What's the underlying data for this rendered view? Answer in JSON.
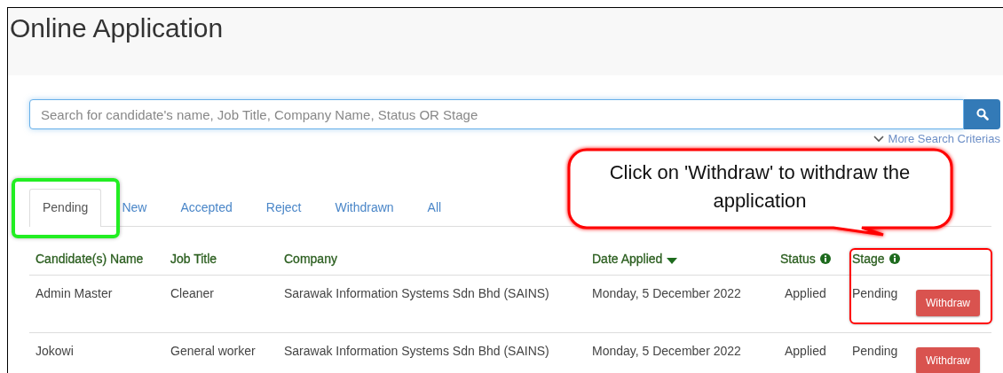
{
  "page_title": "Online Application",
  "search": {
    "placeholder": "Search for candidate's name, Job Title, Company Name, Status OR Stage"
  },
  "more_criteria": "More Search Criterias",
  "tabs": [
    {
      "label": "Pending",
      "selected": true
    },
    {
      "label": "New",
      "selected": false
    },
    {
      "label": "Accepted",
      "selected": false
    },
    {
      "label": "Reject",
      "selected": false
    },
    {
      "label": "Withdrawn",
      "selected": false
    },
    {
      "label": "All",
      "selected": false
    }
  ],
  "table": {
    "columns": [
      {
        "label": "Candidate(s) Name",
        "info": false,
        "sorted": false
      },
      {
        "label": "Job Title",
        "info": false,
        "sorted": false
      },
      {
        "label": "Company",
        "info": false,
        "sorted": false
      },
      {
        "label": "Date Applied",
        "info": false,
        "sorted": true
      },
      {
        "label": "Status",
        "info": true,
        "sorted": false
      },
      {
        "label": "Stage",
        "info": true,
        "sorted": false
      }
    ],
    "rows": [
      {
        "candidate": "Admin Master",
        "job_title": "Cleaner",
        "company": "Sarawak Information Systems Sdn Bhd (SAINS)",
        "date_applied": "Monday, 5 December 2022",
        "status": "Applied",
        "stage": "Pending",
        "action": "Withdraw"
      },
      {
        "candidate": "Jokowi",
        "job_title": "General worker",
        "company": "Sarawak Information Systems Sdn Bhd (SAINS)",
        "date_applied": "Monday, 5 December 2022",
        "status": "Applied",
        "stage": "Pending",
        "action": "Withdraw"
      }
    ]
  },
  "annotations": [
    {
      "kind": "highlight",
      "color": "#22ee22"
    },
    {
      "kind": "highlight",
      "color": "#ff0000"
    },
    {
      "kind": "callout",
      "text": "Click on 'Withdraw' to withdraw the application",
      "color": "#ff0000"
    }
  ]
}
